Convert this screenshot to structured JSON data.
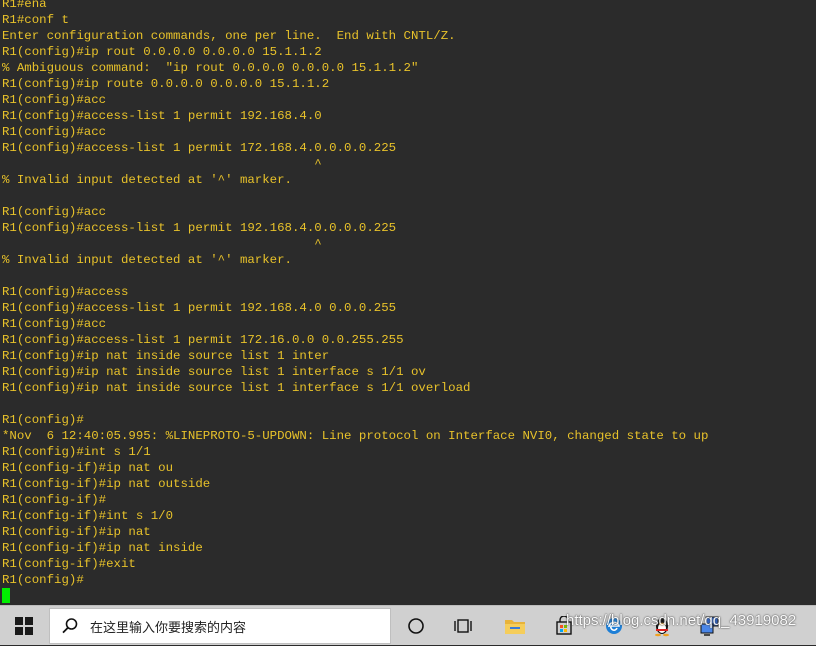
{
  "terminal": {
    "lines": [
      "R1#ena",
      "R1#conf t",
      "Enter configuration commands, one per line.  End with CNTL/Z.",
      "R1(config)#ip rout 0.0.0.0 0.0.0.0 15.1.1.2",
      "% Ambiguous command:  \"ip rout 0.0.0.0 0.0.0.0 15.1.1.2\"",
      "R1(config)#ip route 0.0.0.0 0.0.0.0 15.1.1.2",
      "R1(config)#acc",
      "R1(config)#access-list 1 permit 192.168.4.0",
      "R1(config)#acc",
      "R1(config)#access-list 1 permit 172.168.4.0.0.0.0.225",
      "                                          ^",
      "% Invalid input detected at '^' marker.",
      "",
      "R1(config)#acc",
      "R1(config)#access-list 1 permit 192.168.4.0.0.0.0.225",
      "                                          ^",
      "% Invalid input detected at '^' marker.",
      "",
      "R1(config)#access",
      "R1(config)#access-list 1 permit 192.168.4.0 0.0.0.255",
      "R1(config)#acc",
      "R1(config)#access-list 1 permit 172.16.0.0 0.0.255.255",
      "R1(config)#ip nat inside source list 1 inter",
      "R1(config)#ip nat inside source list 1 interface s 1/1 ov",
      "R1(config)#ip nat inside source list 1 interface s 1/1 overload",
      "",
      "R1(config)#",
      "*Nov  6 12:40:05.995: %LINEPROTO-5-UPDOWN: Line protocol on Interface NVI0, changed state to up",
      "R1(config)#int s 1/1",
      "R1(config-if)#ip nat ou",
      "R1(config-if)#ip nat outside",
      "R1(config-if)#",
      "R1(config-if)#int s 1/0",
      "R1(config-if)#ip nat",
      "R1(config-if)#ip nat inside",
      "R1(config-if)#exit",
      "R1(config)#"
    ],
    "text_color": "#e8c22a",
    "background_color": "#2b2b2b",
    "cursor_color": "#00ee00"
  },
  "taskbar": {
    "start_icon": "windows-logo-icon",
    "search_icon": "search-icon",
    "search_placeholder": "在这里输入你要搜索的内容",
    "icons": [
      "cortana-circle-icon",
      "task-view-icon",
      "file-explorer-icon",
      "store-bag-icon",
      "edge-browser-icon",
      "qq-penguin-icon",
      "network-computer-icon"
    ],
    "watermark": "https://blog.csdn.net/qq_43919082"
  }
}
